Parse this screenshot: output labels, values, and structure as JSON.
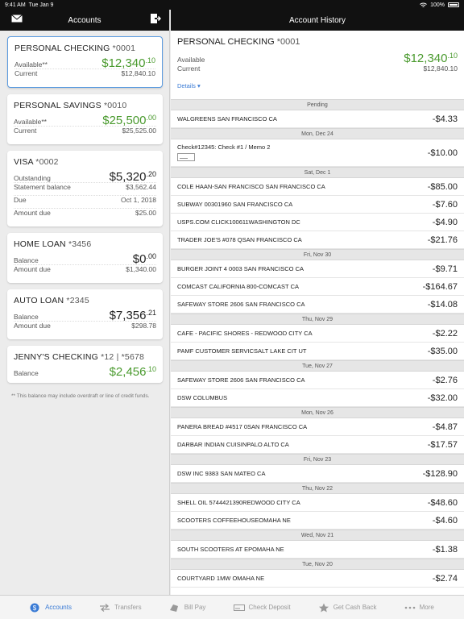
{
  "status": {
    "time": "9:41 AM",
    "date": "Tue Jan 9",
    "battery": "100%"
  },
  "left_header": {
    "title": "Accounts"
  },
  "right_header": {
    "title": "Account History"
  },
  "accounts": [
    {
      "name": "PERSONAL CHECKING",
      "num": "*0001",
      "selected": true,
      "rows": [
        {
          "label": "Available**",
          "value": "$12,340",
          "cents": ".10",
          "big": true,
          "green": true
        },
        {
          "label": "Current",
          "value": "$12,840.10"
        }
      ]
    },
    {
      "name": "PERSONAL SAVINGS",
      "num": "*0010",
      "rows": [
        {
          "label": "Available**",
          "value": "$25,500",
          "cents": ".00",
          "big": true,
          "green": true
        },
        {
          "label": "Current",
          "value": "$25,525.00"
        }
      ]
    },
    {
      "name": "VISA",
      "num": "*0002",
      "rows": [
        {
          "label": "Outstanding",
          "value": "$5,320",
          "cents": ".20",
          "big": true
        },
        {
          "label": "Statement balance",
          "value": "$3,562.44"
        },
        {
          "label": "Due",
          "value": "Oct 1, 2018"
        },
        {
          "label": "Amount due",
          "value": "$25.00"
        }
      ]
    },
    {
      "name": "HOME LOAN",
      "num": "*3456",
      "rows": [
        {
          "label": "Balance",
          "value": "$0",
          "cents": ".00",
          "big": true
        },
        {
          "label": "Amount due",
          "value": "$1,340.00"
        }
      ]
    },
    {
      "name": "AUTO LOAN",
      "num": "*2345",
      "rows": [
        {
          "label": "Balance",
          "value": "$7,356",
          "cents": ".21",
          "big": true
        },
        {
          "label": "Amount due",
          "value": "$298.78"
        }
      ]
    },
    {
      "name": "JENNY'S CHECKING",
      "num": "*12 | *5678",
      "rows": [
        {
          "label": "Balance",
          "value": "$2,456",
          "cents": ".10",
          "big": true,
          "green": true
        }
      ]
    }
  ],
  "footnote": "** This balance may include overdraft or line of credit funds.",
  "detail": {
    "name": "PERSONAL CHECKING",
    "num": "*0001",
    "available_label": "Available",
    "available_value": "$12,340",
    "available_cents": ".10",
    "current_label": "Current",
    "current_value": "$12,840.10",
    "details_link": "Details"
  },
  "history": [
    {
      "sep": "Pending"
    },
    {
      "desc": "WALGREENS SAN FRANCISCO CA",
      "amt": "-$4.33"
    },
    {
      "sep": "Mon, Dec 24"
    },
    {
      "desc": "Check#12345: Check #1 / Memo 2",
      "amt": "-$10.00",
      "check": true
    },
    {
      "sep": "Sat, Dec 1"
    },
    {
      "desc": "COLE HAAN-SAN FRANCISCO SAN FRANCISCO CA",
      "amt": "-$85.00"
    },
    {
      "desc": "SUBWAY 00301960 SAN FRANCISCO CA",
      "amt": "-$7.60"
    },
    {
      "desc": "USPS.COM CLICK100611WASHINGTON DC",
      "amt": "-$4.90"
    },
    {
      "desc": "TRADER JOE'S #078 QSAN FRANCISCO CA",
      "amt": "-$21.76"
    },
    {
      "sep": "Fri, Nov 30"
    },
    {
      "desc": "BURGER JOINT 4 0003 SAN FRANCISCO CA",
      "amt": "-$9.71"
    },
    {
      "desc": "COMCAST CALIFORNIA 800-COMCAST CA",
      "amt": "-$164.67"
    },
    {
      "desc": "SAFEWAY STORE 2606 SAN FRANCISCO CA",
      "amt": "-$14.08"
    },
    {
      "sep": "Thu, Nov 29"
    },
    {
      "desc": "CAFE - PACIFIC SHORES - REDWOOD CITY CA",
      "amt": "-$2.22"
    },
    {
      "desc": "PAMF CUSTOMER SERVICSALT LAKE CIT UT",
      "amt": "-$35.00"
    },
    {
      "sep": "Tue, Nov 27"
    },
    {
      "desc": "SAFEWAY STORE 2606 SAN FRANCISCO CA",
      "amt": "-$2.76"
    },
    {
      "desc": "DSW COLUMBUS",
      "amt": "-$32.00"
    },
    {
      "sep": "Mon, Nov 26"
    },
    {
      "desc": "PANERA BREAD #4517 0SAN FRANCISCO CA",
      "amt": "-$4.87"
    },
    {
      "desc": "DARBAR INDIAN CUISINPALO ALTO CA",
      "amt": "-$17.57"
    },
    {
      "sep": "Fri, Nov 23"
    },
    {
      "desc": "DSW INC 9383 SAN MATEO CA",
      "amt": "-$128.90"
    },
    {
      "sep": "Thu, Nov 22"
    },
    {
      "desc": "SHELL OIL 5744421390REDWOOD CITY CA",
      "amt": "-$48.60"
    },
    {
      "desc": "SCOOTERS COFFEEHOUSEOMAHA NE",
      "amt": "-$4.60"
    },
    {
      "sep": "Wed, Nov 21"
    },
    {
      "desc": "SOUTH SCOOTERS AT EPOMAHA NE",
      "amt": "-$1.38"
    },
    {
      "sep": "Tue, Nov 20"
    },
    {
      "desc": "COURTYARD 1MW OMAHA NE",
      "amt": "-$2.74"
    }
  ],
  "tabs": [
    {
      "label": "Accounts",
      "icon": "dollar-circle-icon",
      "active": true
    },
    {
      "label": "Transfers",
      "icon": "transfer-arrows-icon"
    },
    {
      "label": "Bill Pay",
      "icon": "bill-pay-icon"
    },
    {
      "label": "Check Deposit",
      "icon": "check-deposit-icon"
    },
    {
      "label": "Get Cash Back",
      "icon": "star-icon"
    },
    {
      "label": "More",
      "icon": "more-dots-icon"
    }
  ],
  "colors": {
    "accent": "#3a7bd5",
    "positive": "#4a9a2e",
    "header": "#111111"
  }
}
